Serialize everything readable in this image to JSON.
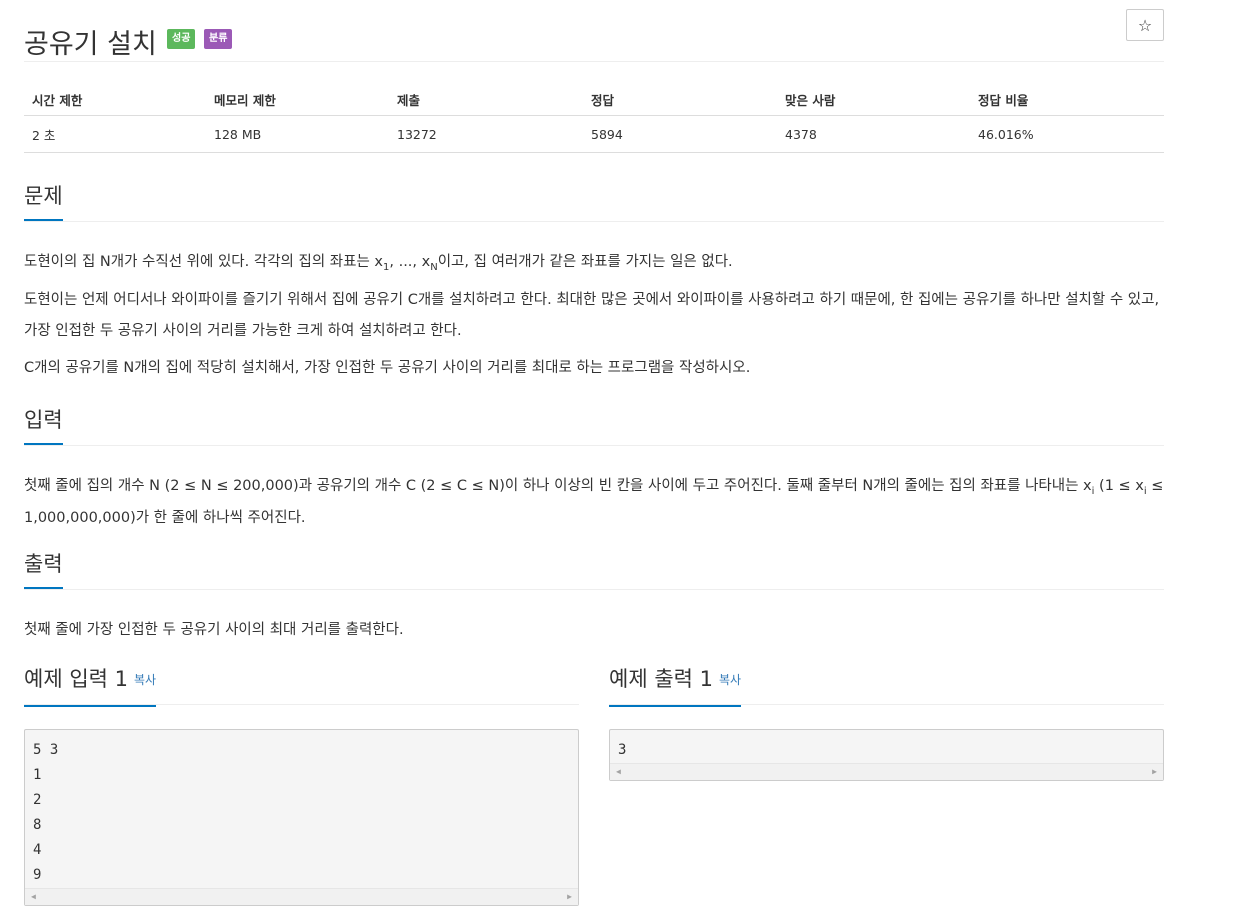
{
  "problem": {
    "title": "공유기 설치",
    "badge_success": "성공",
    "badge_tag": "분류",
    "star_icon": "☆"
  },
  "info_table": {
    "headers": [
      "시간 제한",
      "메모리 제한",
      "제출",
      "정답",
      "맞은 사람",
      "정답 비율"
    ],
    "values": [
      "2 초",
      "128 MB",
      "13272",
      "5894",
      "4378",
      "46.016%"
    ]
  },
  "sections": {
    "description": {
      "heading": "문제",
      "p1_before": "도현이의 집 N개가 수직선 위에 있다. 각각의 집의 좌표는 x",
      "p1_sub1": "1",
      "p1_mid": ", ..., x",
      "p1_subN": "N",
      "p1_after": "이고, 집 여러개가 같은 좌표를 가지는 일은 없다.",
      "p2": "도현이는 언제 어디서나 와이파이를 즐기기 위해서 집에 공유기 C개를 설치하려고 한다. 최대한 많은 곳에서 와이파이를 사용하려고 하기 때문에, 한 집에는 공유기를 하나만 설치할 수 있고, 가장 인접한 두 공유기 사이의 거리를 가능한 크게 하여 설치하려고 한다.",
      "p3": "C개의 공유기를 N개의 집에 적당히 설치해서, 가장 인접한 두 공유기 사이의 거리를 최대로 하는 프로그램을 작성하시오."
    },
    "input": {
      "heading": "입력",
      "p1_before": "첫째 줄에 집의 개수 N (2 ≤ N ≤ 200,000)과 공유기의 개수 C (2 ≤ C ≤ N)이 하나 이상의 빈 칸을 사이에 두고 주어진다. 둘째 줄부터 N개의 줄에는 집의 좌표를 나타내는 x",
      "p1_sub1": "i",
      "p1_mid": " (1 ≤ x",
      "p1_sub2": "i",
      "p1_after": " ≤ 1,000,000,000)가 한 줄에 하나씩 주어진다."
    },
    "output": {
      "heading": "출력",
      "p1": "첫째 줄에 가장 인접한 두 공유기 사이의 최대 거리를 출력한다."
    }
  },
  "samples": {
    "input": {
      "heading": "예제 입력 1",
      "copy_label": "복사",
      "lines": [
        "5 3",
        "1",
        "2",
        "8",
        "4",
        "9"
      ]
    },
    "output": {
      "heading": "예제 출력 1",
      "copy_label": "복사",
      "lines": [
        "3"
      ]
    },
    "scroll_left_icon": "◀",
    "scroll_right_icon": "▶"
  }
}
